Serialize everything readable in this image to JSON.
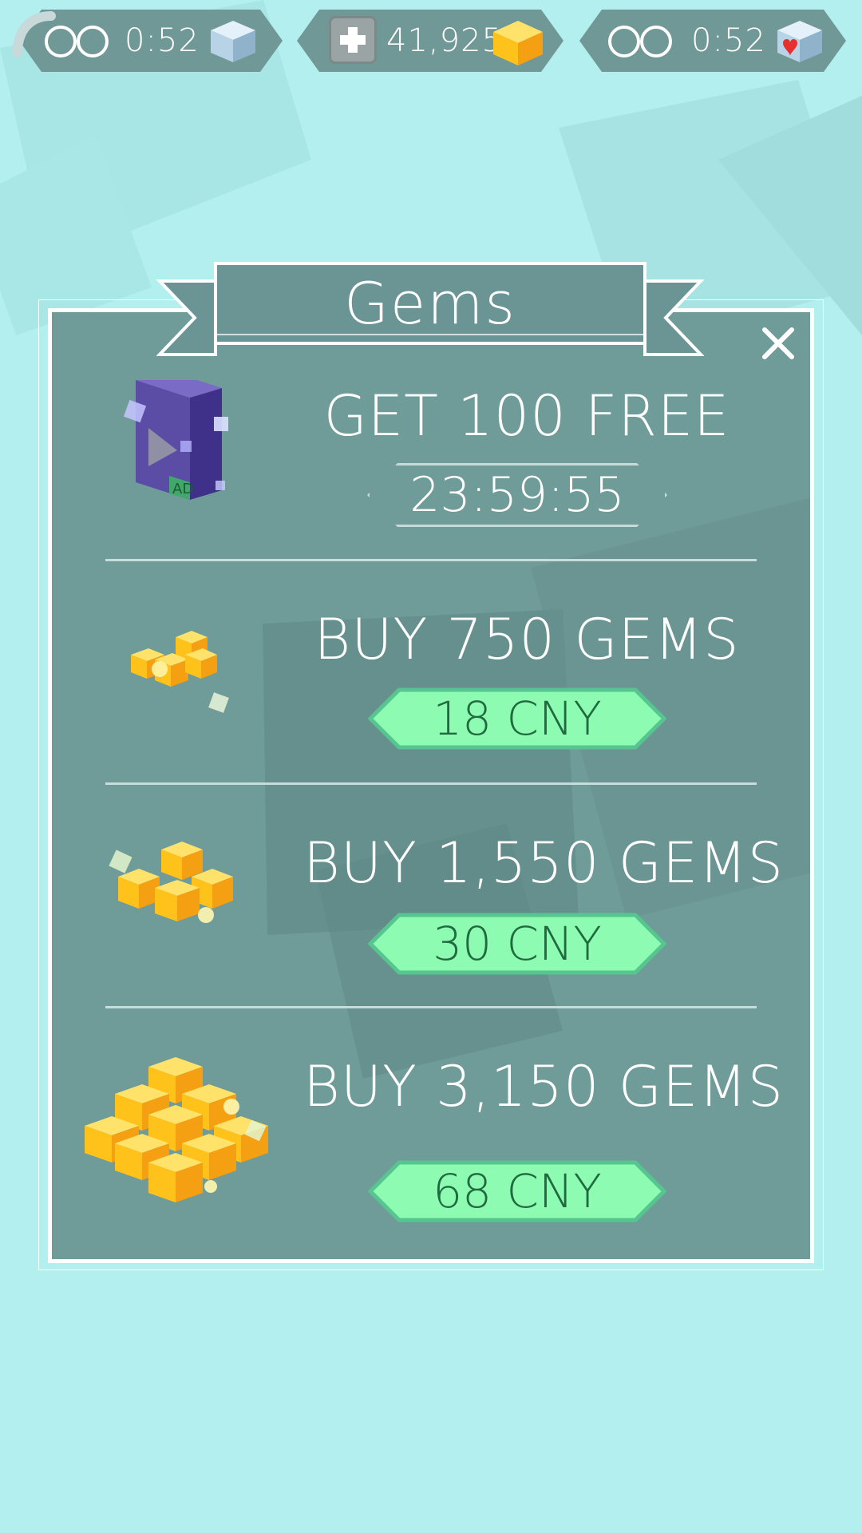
{
  "hud": {
    "left": {
      "timer": "0:52",
      "icon": "white-cube-icon"
    },
    "center": {
      "gems": "41,925",
      "icon": "gold-gem-icon"
    },
    "right": {
      "timer": "0:52",
      "icon": "heart-cube-icon"
    }
  },
  "dialog": {
    "title": "Gems",
    "close_icon": "close-icon"
  },
  "offers": [
    {
      "title": "GET 100 FREE",
      "timer": "23:59:55",
      "icon": "ad-video-icon"
    },
    {
      "title": "BUY 750 GEMS",
      "price": "18 CNY",
      "icon": "small-gem-pile-icon"
    },
    {
      "title": "BUY 1,550 GEMS",
      "price": "30 CNY",
      "icon": "medium-gem-pile-icon"
    },
    {
      "title": "BUY 3,150 GEMS",
      "price": "68 CNY",
      "icon": "large-gem-pile-icon"
    }
  ],
  "colors": {
    "background": "#b2efee",
    "panel": "#6f9b99",
    "price_button": "#8dfcb2",
    "price_text": "#1f6b3e",
    "gem_gold": "#ffc21a"
  }
}
